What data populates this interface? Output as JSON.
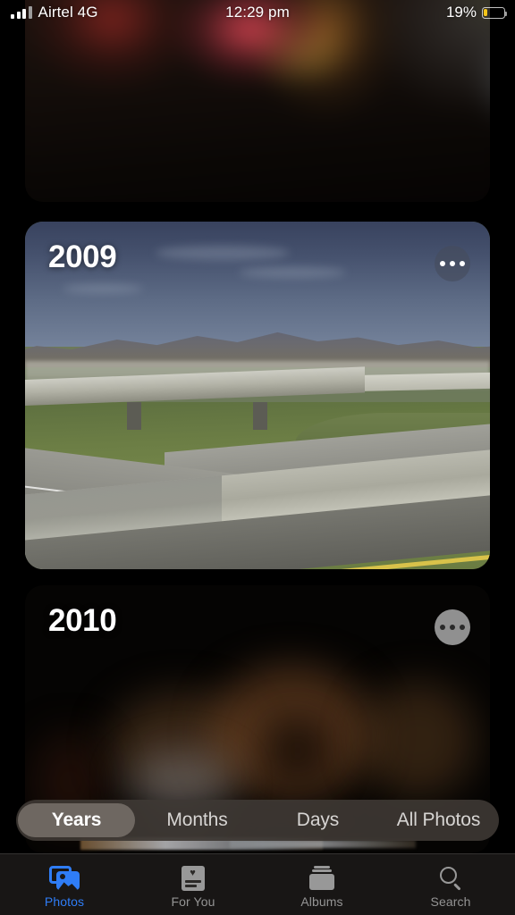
{
  "status_bar": {
    "carrier": "Airtel 4G",
    "time": "12:29 pm",
    "battery_percent": "19%",
    "battery_level": 19,
    "battery_color": "#f5c518",
    "signal_bars_filled": 3,
    "signal_bars_total": 4
  },
  "screen": {
    "app": "Photos",
    "view": "Years"
  },
  "cards": [
    {
      "id": "card-top",
      "year": "",
      "menu_label": "•••",
      "description": "partially visible blurred dark photo"
    },
    {
      "id": "card-2009",
      "year": "2009",
      "menu_label": "•••",
      "description": "highway overpass with mountains"
    },
    {
      "id": "card-2010",
      "year": "2010",
      "menu_label": "•••",
      "description": "dark blurred night photo"
    }
  ],
  "segmented_control": {
    "selected": "Years",
    "options": [
      {
        "label": "Years",
        "selected": true
      },
      {
        "label": "Months",
        "selected": false
      },
      {
        "label": "Days",
        "selected": false
      },
      {
        "label": "All Photos",
        "selected": false
      }
    ]
  },
  "tab_bar": {
    "active": "Photos",
    "accent_color": "#2f7df6",
    "inactive_color": "#949494",
    "tabs": [
      {
        "label": "Photos",
        "icon": "photos-stack-icon",
        "active": true
      },
      {
        "label": "For You",
        "icon": "for-you-heart-card-icon",
        "active": false
      },
      {
        "label": "Albums",
        "icon": "albums-stack-icon",
        "active": false
      },
      {
        "label": "Search",
        "icon": "magnifying-glass-icon",
        "active": false
      }
    ]
  }
}
